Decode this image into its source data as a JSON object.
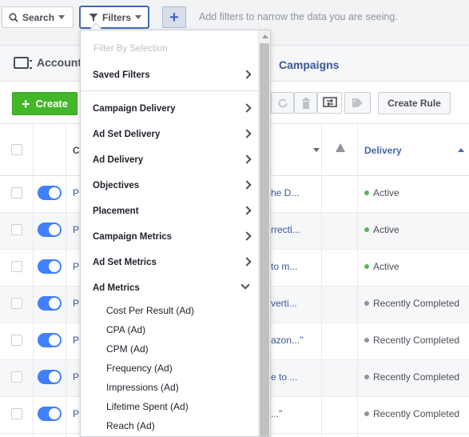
{
  "filterbar": {
    "search_label": "Search",
    "filters_label": "Filters",
    "add_label": "+",
    "hint": "Add filters to narrow the data you are seeing."
  },
  "header": {
    "account_label": "Account",
    "campaigns_tab": "Campaigns"
  },
  "toolbar": {
    "create_label": "Create",
    "create_rule_label": "Create Rule"
  },
  "table": {
    "first_col_header": "C",
    "delivery_header": "Delivery",
    "rows": [
      {
        "name": "P",
        "snippet": "he D...",
        "status": "Active",
        "status_color": "#5fb15f"
      },
      {
        "name": "P",
        "snippet": "rrectl...",
        "status": "Active",
        "status_color": "#5fb15f"
      },
      {
        "name": "P",
        "snippet": "to m...",
        "status": "Active",
        "status_color": "#5fb15f"
      },
      {
        "name": "P",
        "snippet": "verti...",
        "status": "Recently Completed",
        "status_color": "#90949c"
      },
      {
        "name": "P",
        "snippet": "azon...\"",
        "status": "Recently Completed",
        "status_color": "#90949c"
      },
      {
        "name": "P",
        "snippet": "e to ...",
        "status": "Recently Completed",
        "status_color": "#90949c"
      },
      {
        "name": "P",
        "snippet": "...\"",
        "status": "Recently Completed",
        "status_color": "#90949c"
      }
    ]
  },
  "dropdown": {
    "heading": "Filter By Selection",
    "items": [
      {
        "label": "Saved Filters",
        "state": "collapsed"
      },
      {
        "label": "Campaign Delivery",
        "state": "collapsed"
      },
      {
        "label": "Ad Set Delivery",
        "state": "collapsed"
      },
      {
        "label": "Ad Delivery",
        "state": "collapsed"
      },
      {
        "label": "Objectives",
        "state": "collapsed"
      },
      {
        "label": "Placement",
        "state": "collapsed"
      },
      {
        "label": "Campaign Metrics",
        "state": "collapsed"
      },
      {
        "label": "Ad Set Metrics",
        "state": "collapsed"
      },
      {
        "label": "Ad Metrics",
        "state": "expanded"
      }
    ],
    "sub_items": [
      "Cost Per Result (Ad)",
      "CPA (Ad)",
      "CPM (Ad)",
      "Frequency (Ad)",
      "Impressions (Ad)",
      "Lifetime Spent (Ad)",
      "Reach (Ad)"
    ]
  },
  "colors": {
    "accent": "#4267b2",
    "link": "#365899",
    "create_green": "#42b72a",
    "toggle_blue": "#4080ff"
  }
}
